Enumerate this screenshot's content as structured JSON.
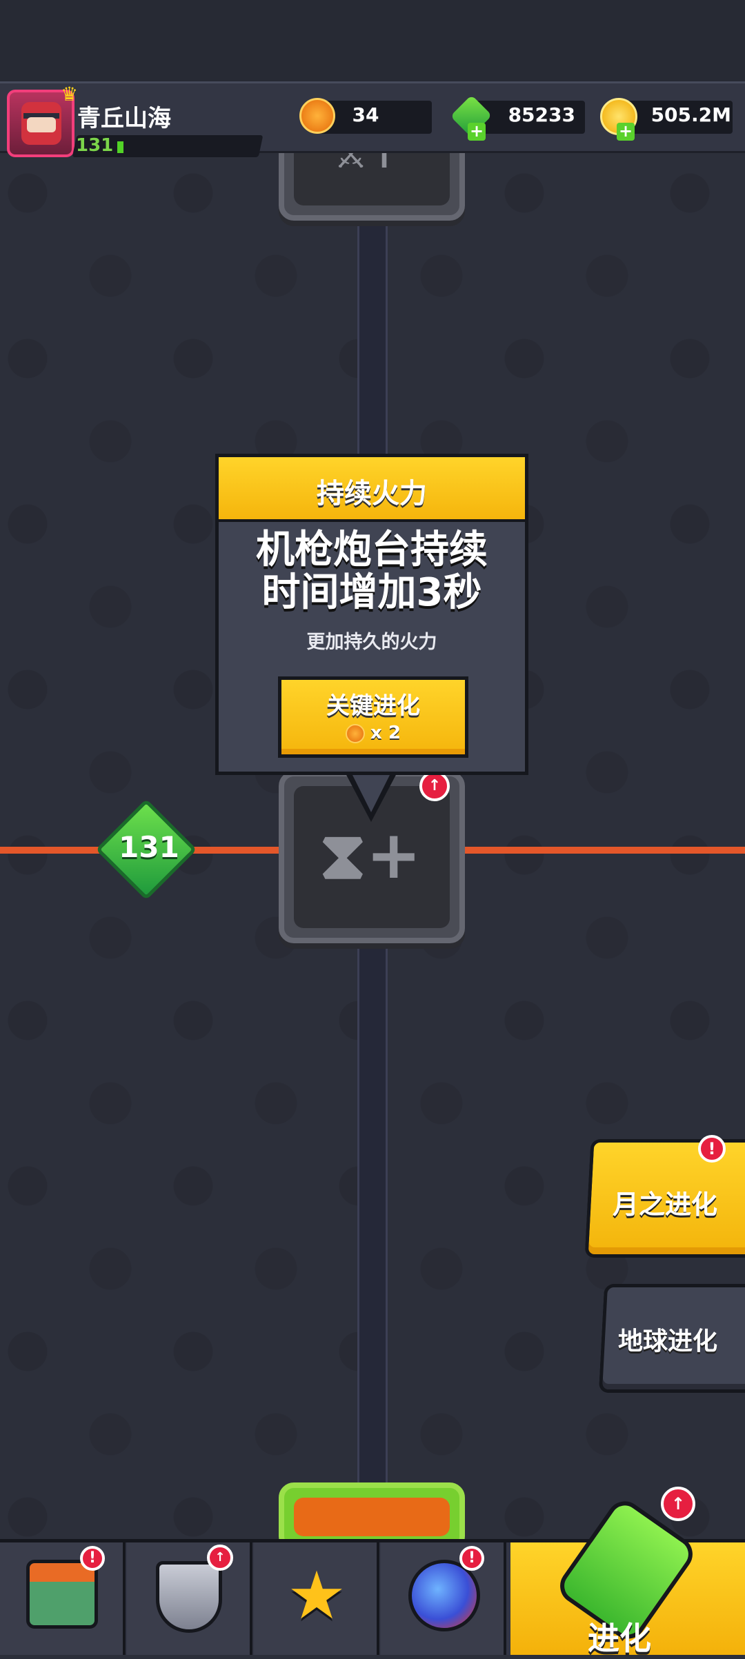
{
  "player": {
    "name": "青丘山海",
    "level": "131"
  },
  "resources": {
    "orange_coin": "34",
    "gems": "85233",
    "gold": "505.2M"
  },
  "icons": {
    "avatar": "ninja-avatar",
    "orange_coin": "orange-core-icon",
    "gems": "green-gem-icon",
    "gold": "gold-coin-icon",
    "node_top": "blade-upgrade-icon",
    "node_mid": "hourglass-plus-icon"
  },
  "track": {
    "level_marker": "131"
  },
  "popup": {
    "title": "持续火力",
    "description_line1": "机枪炮台持续",
    "description_line2": "时间增加3秒",
    "subtitle": "更加持久的火力",
    "button_label": "关键进化",
    "button_cost": "x 2"
  },
  "side_buttons": {
    "moon": "月之进化",
    "earth": "地球进化"
  },
  "nav": {
    "items": [
      {
        "name": "shop",
        "icon": "shop-icon",
        "alert": "!"
      },
      {
        "name": "rank",
        "icon": "medal-icon",
        "alert": "up"
      },
      {
        "name": "battle",
        "icon": "crossed-swords-star-icon",
        "alert": ""
      },
      {
        "name": "planet",
        "icon": "planet-icon",
        "alert": "!"
      }
    ],
    "active_label": "进化"
  },
  "colors": {
    "accent_yellow": "#f5b50c",
    "accent_green": "#52d327",
    "alert_red": "#e61f40",
    "track_line": "#e4572a"
  }
}
